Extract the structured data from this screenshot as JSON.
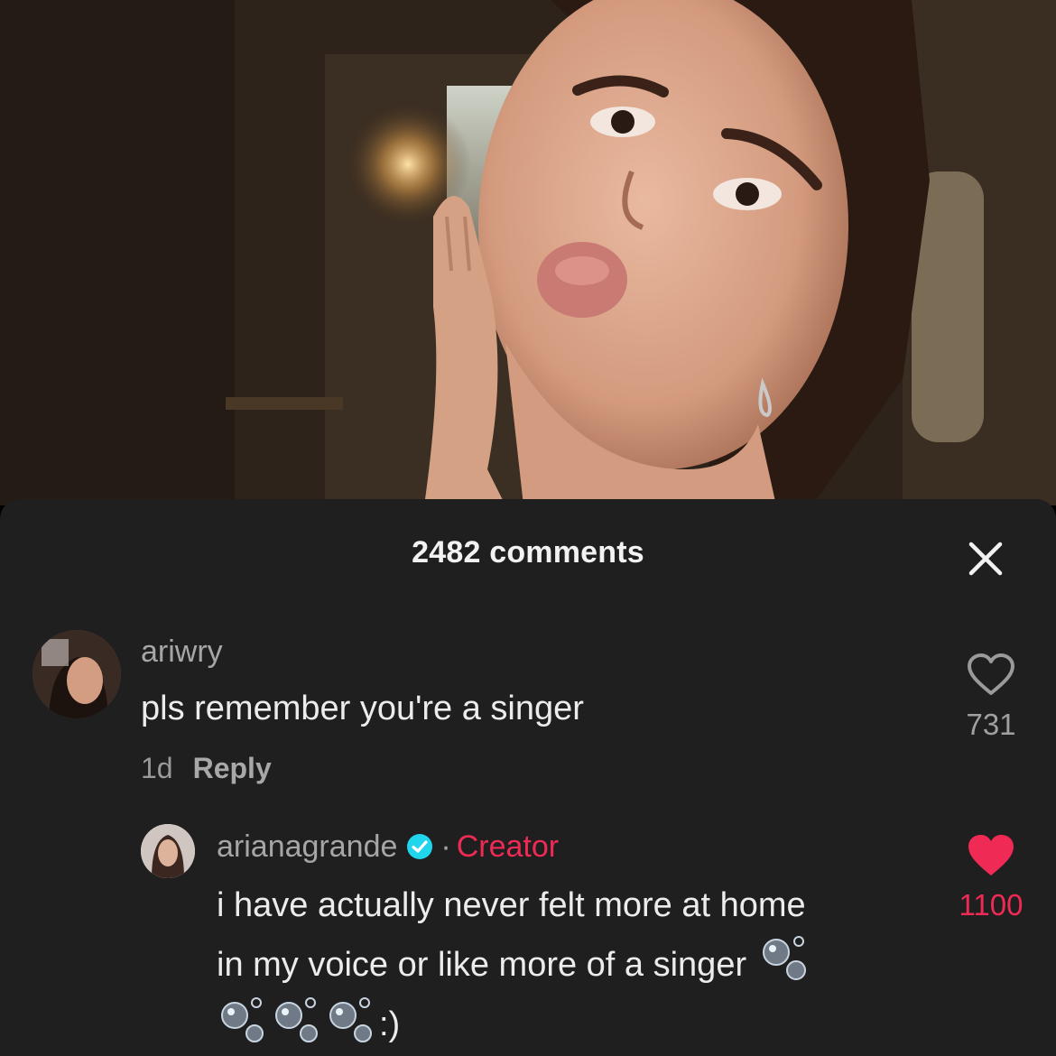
{
  "comments_panel": {
    "title": "2482 comments",
    "comments": [
      {
        "username": "ariwry",
        "text": "pls remember you're a singer",
        "time": "1d",
        "reply_label": "Reply",
        "likes": "731",
        "liked": false
      }
    ],
    "reply": {
      "username": "arianagrande",
      "verified": true,
      "separator": "·",
      "badge": "Creator",
      "text_line1": "i have actually never felt more at home",
      "text_line2": "in my voice or like more of a singer",
      "text_end": ":)",
      "emoji": "bubbles",
      "likes": "1100",
      "liked": true
    }
  },
  "colors": {
    "sheet_bg": "#1f1f1f",
    "accent_red": "#ef2a55",
    "verified_blue": "#20d5ec"
  },
  "icons": [
    "close-icon",
    "heart-outline-icon",
    "heart-filled-icon",
    "verified-badge-icon",
    "bubbles-emoji"
  ]
}
